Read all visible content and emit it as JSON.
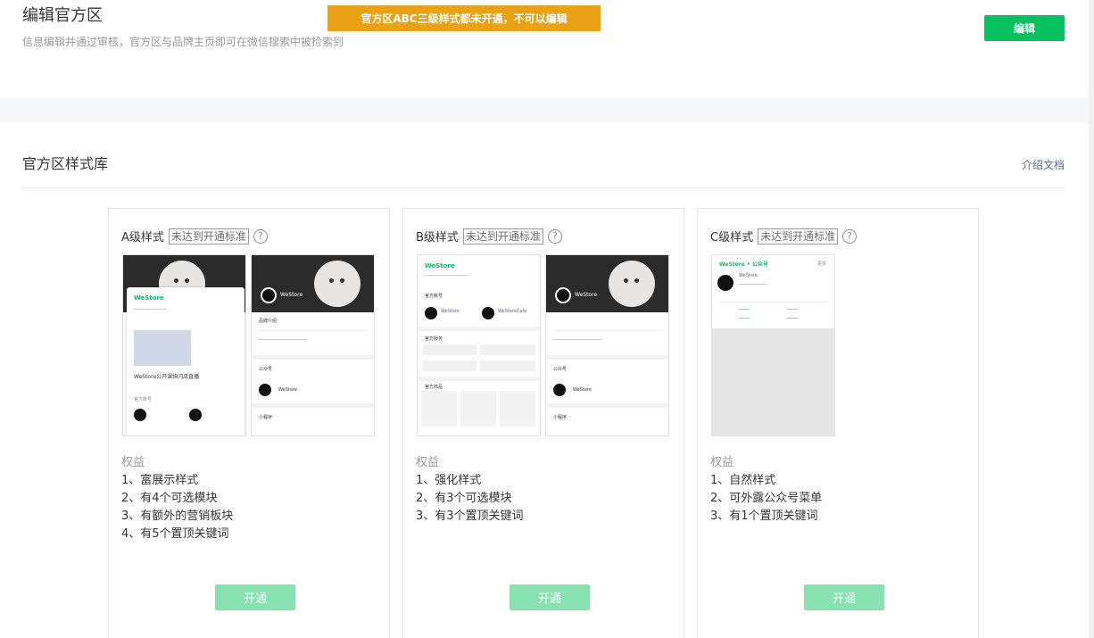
{
  "header": {
    "title": "编辑官方区",
    "description": "信息编辑并通过审核，官方区与品牌主页即可在微信搜索中被检索到",
    "warning": "官方区ABC三级样式都未开通，不可以编辑",
    "edit_label": "编辑"
  },
  "library": {
    "title": "官方区样式库",
    "doc_link": "介绍文档"
  },
  "cards": [
    {
      "title": "A级样式",
      "tag": "未达到开通标准",
      "benefits_title": "权益",
      "benefits": [
        "1、富展示样式",
        "2、有4个可选模块",
        "3、有额外的营销板块",
        "4、有5个置顶关键词"
      ],
      "button": "开通"
    },
    {
      "title": "B级样式",
      "tag": "未达到开通标准",
      "benefits_title": "权益",
      "benefits": [
        "1、强化样式",
        "2、有3个可选模块",
        "3、有3个置顶关键词"
      ],
      "button": "开通"
    },
    {
      "title": "C级样式",
      "tag": "未达到开通标准",
      "benefits_title": "权益",
      "benefits": [
        "1、自然样式",
        "2、可外露公众号菜单",
        "3、有1个置顶关键词"
      ],
      "button": "开通"
    }
  ],
  "preview": {
    "brand": "WeStore",
    "brand_cn": "WeStoreCafe",
    "live_title": "WeStore公开课快闪店直播",
    "gzh": "公众号",
    "mini": "小程序",
    "official_account": "官方账号",
    "official_service": "官方服务",
    "official_product": "官方商品",
    "brand_intro": "品牌介绍",
    "weststore_gzh_header": "WeStore • 公众号",
    "more": "更多"
  },
  "colors": {
    "primary": "#07c160",
    "warning": "#e9a116",
    "disabled": "#87e1b0",
    "link": "#576b95"
  }
}
